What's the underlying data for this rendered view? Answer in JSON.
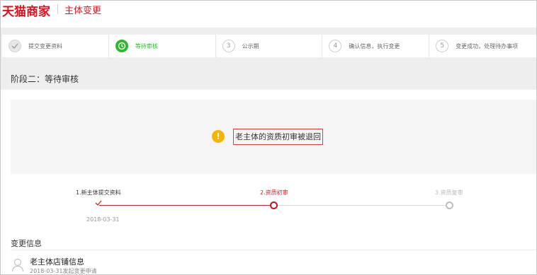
{
  "header": {
    "logo": "天猫商家",
    "title": "主体变更"
  },
  "steps": [
    {
      "num": "✓",
      "label": "提交变更资料",
      "state": "done"
    },
    {
      "num": "",
      "label": "等待审核",
      "state": "active"
    },
    {
      "num": "3",
      "label": "公示期",
      "state": "todo"
    },
    {
      "num": "4",
      "label": "确认信息，执行变更",
      "state": "todo"
    },
    {
      "num": "5",
      "label": "变更成功，处理待办事项",
      "state": "todo"
    }
  ],
  "stage": {
    "title": "阶段二：等待审核"
  },
  "notice": {
    "icon": "!",
    "text": "老主体的资质初审被退回"
  },
  "progress": {
    "nodes": [
      {
        "label": "1.新主体提交资料",
        "state": "done",
        "date": "2018-03-31"
      },
      {
        "label": "2.资质初审",
        "state": "active"
      },
      {
        "label": "3.资质复审",
        "state": "todo"
      }
    ]
  },
  "change_info": {
    "title": "变更信息",
    "store_name": "老主体店铺信息",
    "store_sub": "2018-03-31发起变更申请"
  },
  "colors": {
    "brand": "#e0101e",
    "active_step": "#2cb72c",
    "warning": "#f7b500",
    "progress": "#d0212b"
  }
}
